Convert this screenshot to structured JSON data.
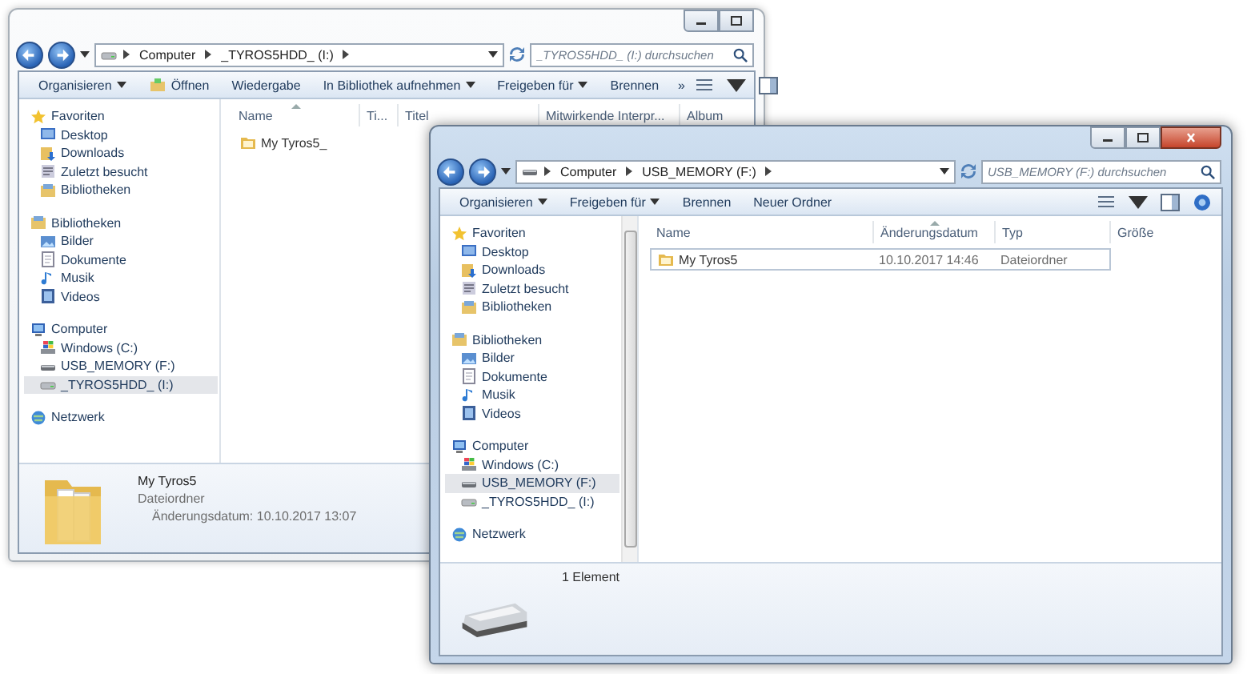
{
  "windows": [
    {
      "active": false,
      "controls": [
        {
          "kind": "minimize"
        },
        {
          "kind": "maximize"
        }
      ],
      "address": {
        "segments": [
          "Computer",
          "_TYROS5HDD_ (I:)"
        ],
        "kind": "hdd"
      },
      "search": {
        "placeholder": "_TYROS5HDD_ (I:) durchsuchen"
      },
      "toolbar": [
        {
          "label": "Organisieren",
          "menu": true,
          "kind": "plain"
        },
        {
          "label": "Öffnen",
          "menu": false,
          "kind": "open"
        },
        {
          "label": "Wiedergabe",
          "menu": false,
          "kind": "plain"
        },
        {
          "label": "In Bibliothek aufnehmen",
          "menu": true,
          "kind": "plain"
        },
        {
          "label": "Freigeben für",
          "menu": true,
          "kind": "plain"
        },
        {
          "label": "Brennen",
          "menu": false,
          "kind": "plain"
        },
        {
          "label": "»",
          "menu": false,
          "kind": "overflow"
        }
      ],
      "help_button": false,
      "scrollbar": false,
      "sidebar": [
        {
          "label": "Favoriten",
          "kind": "favorites",
          "selected": false,
          "children": [
            {
              "label": "Desktop",
              "kind": "desktop",
              "selected": false
            },
            {
              "label": "Downloads",
              "kind": "downloads",
              "selected": false
            },
            {
              "label": "Zuletzt besucht",
              "kind": "recent",
              "selected": false
            },
            {
              "label": "Bibliotheken",
              "kind": "libraries",
              "selected": false
            }
          ]
        },
        {
          "label": "Bibliotheken",
          "kind": "libraries",
          "selected": false,
          "children": [
            {
              "label": "Bilder",
              "kind": "pictures",
              "selected": false
            },
            {
              "label": "Dokumente",
              "kind": "documents",
              "selected": false
            },
            {
              "label": "Musik",
              "kind": "music",
              "selected": false
            },
            {
              "label": "Videos",
              "kind": "videos",
              "selected": false
            }
          ]
        },
        {
          "label": "Computer",
          "kind": "computer",
          "selected": false,
          "children": [
            {
              "label": "Windows (C:)",
              "kind": "windows-drive",
              "selected": false
            },
            {
              "label": "USB_MEMORY (F:)",
              "kind": "usb-drive",
              "selected": false
            },
            {
              "label": "_TYROS5HDD_ (I:)",
              "kind": "hdd",
              "selected": true
            }
          ]
        },
        {
          "label": "Netzwerk",
          "kind": "network",
          "selected": false
        }
      ],
      "columns": [
        {
          "label": "Name",
          "sorted": true
        },
        {
          "label": "Ti...",
          "sorted": false
        },
        {
          "label": "Titel",
          "sorted": false
        },
        {
          "label": "Mitwirkende Interpr...",
          "sorted": false
        },
        {
          "label": "Album",
          "sorted": false
        }
      ],
      "rows": [
        {
          "cells": [
            "My Tyros5_"
          ],
          "selected": false
        }
      ],
      "details": {
        "kind": "folder",
        "lines": [
          "My Tyros5",
          "Dateiordner",
          "Änderungsdatum: 10.10.2017 13:07"
        ]
      }
    },
    {
      "active": true,
      "controls": [
        {
          "kind": "minimize"
        },
        {
          "kind": "maximize"
        },
        {
          "kind": "close"
        }
      ],
      "address": {
        "segments": [
          "Computer",
          "USB_MEMORY (F:)"
        ],
        "kind": "usb-drive"
      },
      "search": {
        "placeholder": "USB_MEMORY (F:) durchsuchen"
      },
      "toolbar": [
        {
          "label": "Organisieren",
          "menu": true,
          "kind": "plain"
        },
        {
          "label": "Freigeben für",
          "menu": true,
          "kind": "plain"
        },
        {
          "label": "Brennen",
          "menu": false,
          "kind": "plain"
        },
        {
          "label": "Neuer Ordner",
          "menu": false,
          "kind": "plain"
        }
      ],
      "help_button": true,
      "scrollbar": true,
      "sidebar": [
        {
          "label": "Favoriten",
          "kind": "favorites",
          "selected": false,
          "children": [
            {
              "label": "Desktop",
              "kind": "desktop",
              "selected": false
            },
            {
              "label": "Downloads",
              "kind": "downloads",
              "selected": false
            },
            {
              "label": "Zuletzt besucht",
              "kind": "recent",
              "selected": false
            },
            {
              "label": "Bibliotheken",
              "kind": "libraries",
              "selected": false
            }
          ]
        },
        {
          "label": "Bibliotheken",
          "kind": "libraries",
          "selected": false,
          "children": [
            {
              "label": "Bilder",
              "kind": "pictures",
              "selected": false
            },
            {
              "label": "Dokumente",
              "kind": "documents",
              "selected": false
            },
            {
              "label": "Musik",
              "kind": "music",
              "selected": false
            },
            {
              "label": "Videos",
              "kind": "videos",
              "selected": false
            }
          ]
        },
        {
          "label": "Computer",
          "kind": "computer",
          "selected": false,
          "children": [
            {
              "label": "Windows (C:)",
              "kind": "windows-drive",
              "selected": false
            },
            {
              "label": "USB_MEMORY (F:)",
              "kind": "usb-drive",
              "selected": true
            },
            {
              "label": "_TYROS5HDD_ (I:)",
              "kind": "hdd",
              "selected": false
            }
          ]
        },
        {
          "label": "Netzwerk",
          "kind": "network",
          "selected": false
        }
      ],
      "columns": [
        {
          "label": "Name",
          "sorted": false
        },
        {
          "label": "Änderungsdatum",
          "sorted": true
        },
        {
          "label": "Typ",
          "sorted": false
        },
        {
          "label": "Größe",
          "sorted": false
        }
      ],
      "rows": [
        {
          "cells": [
            "My Tyros5",
            "10.10.2017 14:46",
            "Dateiordner"
          ],
          "selected": true
        }
      ],
      "details": {
        "kind": "usb-drive",
        "lines": [
          "1 Element"
        ]
      }
    }
  ]
}
